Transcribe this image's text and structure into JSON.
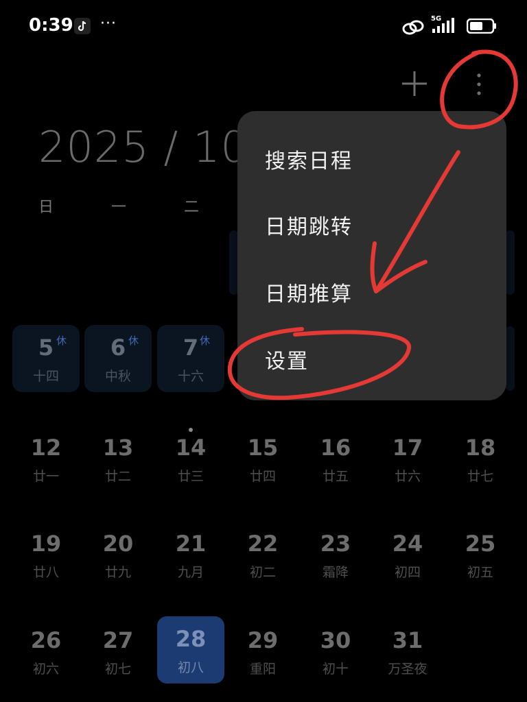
{
  "status_bar": {
    "time": "0:39",
    "more": "···",
    "network": "5G",
    "icons": [
      "tiktok-icon",
      "link-icon",
      "signal-icon",
      "battery-icon"
    ]
  },
  "toolbar": {
    "add_icon": "plus-icon",
    "more_icon": "vertical-dots-icon"
  },
  "calendar": {
    "month_title": "2025 / 10",
    "weekdays": [
      "日",
      "一",
      "二"
    ],
    "rows": [
      [
        {
          "num": "5",
          "lunar": "十四",
          "rest": "休"
        },
        {
          "num": "6",
          "lunar": "中秋",
          "rest": "休"
        },
        {
          "num": "7",
          "lunar": "十六",
          "rest": "休"
        }
      ],
      [
        {
          "num": "12",
          "lunar": "廿一"
        },
        {
          "num": "13",
          "lunar": "廿二"
        },
        {
          "num": "14",
          "lunar": "廿三"
        },
        {
          "num": "15",
          "lunar": "廿四"
        },
        {
          "num": "16",
          "lunar": "廿五"
        },
        {
          "num": "17",
          "lunar": "廿六"
        },
        {
          "num": "18",
          "lunar": "廿七"
        }
      ],
      [
        {
          "num": "19",
          "lunar": "廿八"
        },
        {
          "num": "20",
          "lunar": "廿九"
        },
        {
          "num": "21",
          "lunar": "九月"
        },
        {
          "num": "22",
          "lunar": "初二"
        },
        {
          "num": "23",
          "lunar": "霜降"
        },
        {
          "num": "24",
          "lunar": "初四"
        },
        {
          "num": "25",
          "lunar": "初五"
        }
      ],
      [
        {
          "num": "26",
          "lunar": "初六"
        },
        {
          "num": "27",
          "lunar": "初七"
        },
        {
          "num": "28",
          "lunar": "初八"
        },
        {
          "num": "29",
          "lunar": "重阳"
        },
        {
          "num": "30",
          "lunar": "初十"
        },
        {
          "num": "31",
          "lunar": "万圣夜"
        }
      ]
    ]
  },
  "menu": {
    "items": [
      "搜索日程",
      "日期跳转",
      "日期推算",
      "设置"
    ]
  },
  "colors": {
    "background": "#000000",
    "menu_bg": "#2e2e2e",
    "today_bg": "#1d3b73",
    "holiday_badge": "#3f6bb4",
    "annotation": "#e53935"
  }
}
